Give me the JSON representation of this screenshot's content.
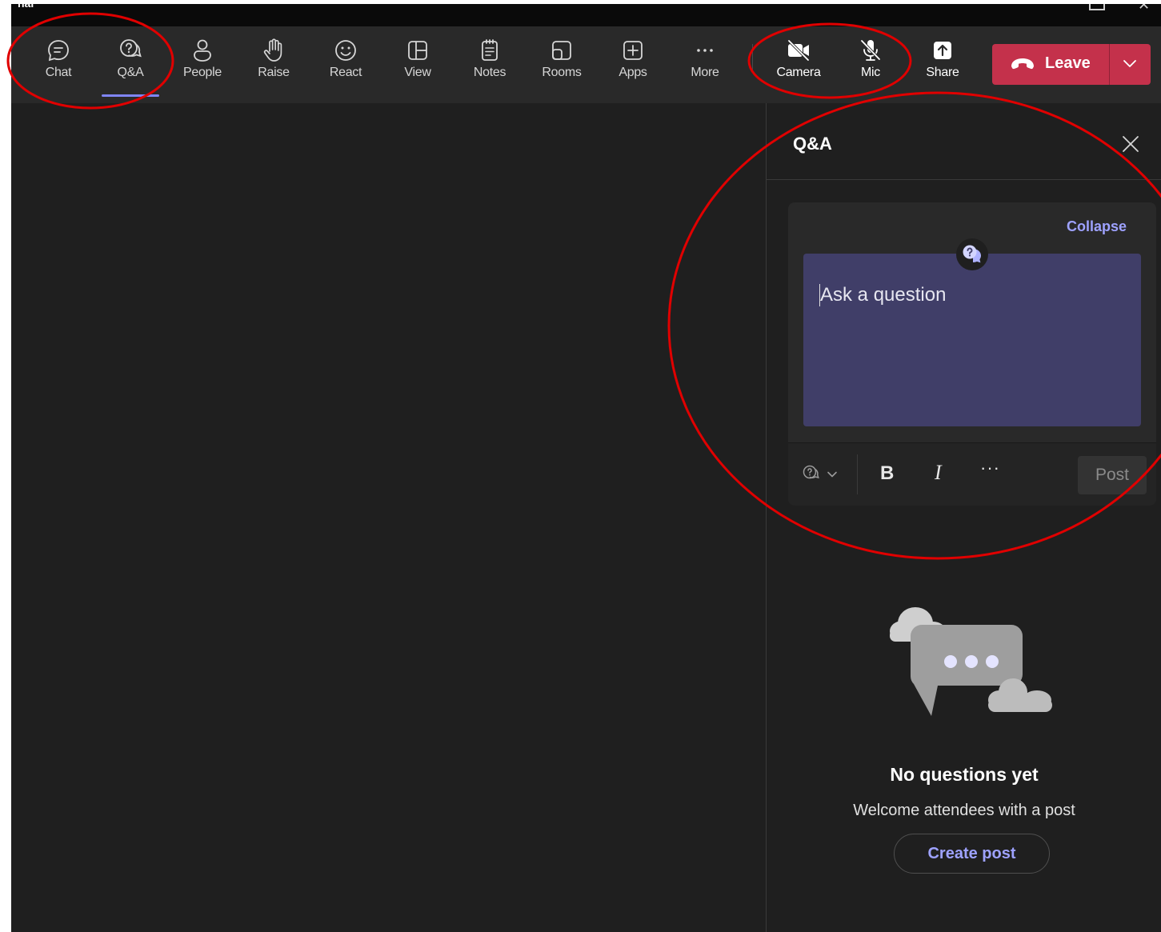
{
  "window": {
    "title": "nal"
  },
  "toolbar": {
    "tools": [
      {
        "id": "chat",
        "label": "Chat",
        "icon": "chat-icon"
      },
      {
        "id": "qa",
        "label": "Q&A",
        "icon": "qa-icon",
        "active": true
      },
      {
        "id": "people",
        "label": "People",
        "icon": "people-icon"
      },
      {
        "id": "raise",
        "label": "Raise",
        "icon": "raise-hand-icon"
      },
      {
        "id": "react",
        "label": "React",
        "icon": "smiley-icon"
      },
      {
        "id": "view",
        "label": "View",
        "icon": "view-grid-icon"
      },
      {
        "id": "notes",
        "label": "Notes",
        "icon": "notes-icon"
      },
      {
        "id": "rooms",
        "label": "Rooms",
        "icon": "rooms-icon"
      },
      {
        "id": "apps",
        "label": "Apps",
        "icon": "apps-plus-icon"
      },
      {
        "id": "more",
        "label": "More",
        "icon": "more-icon"
      },
      {
        "id": "camera",
        "label": "Camera",
        "icon": "camera-off-icon"
      },
      {
        "id": "mic",
        "label": "Mic",
        "icon": "mic-off-icon"
      },
      {
        "id": "share",
        "label": "Share",
        "icon": "share-icon"
      }
    ],
    "leave_label": "Leave",
    "accent_color": "#7f85f5",
    "leave_color": "#c4314b"
  },
  "qa_panel": {
    "title": "Q&A",
    "collapse_label": "Collapse",
    "question_placeholder": "Ask a question",
    "formatting": {
      "bold_label": "B",
      "italic_label": "I",
      "more_label": "···"
    },
    "post_label": "Post",
    "empty_state": {
      "title": "No questions yet",
      "subtitle": "Welcome attendees with a post",
      "create_post_label": "Create post"
    }
  }
}
